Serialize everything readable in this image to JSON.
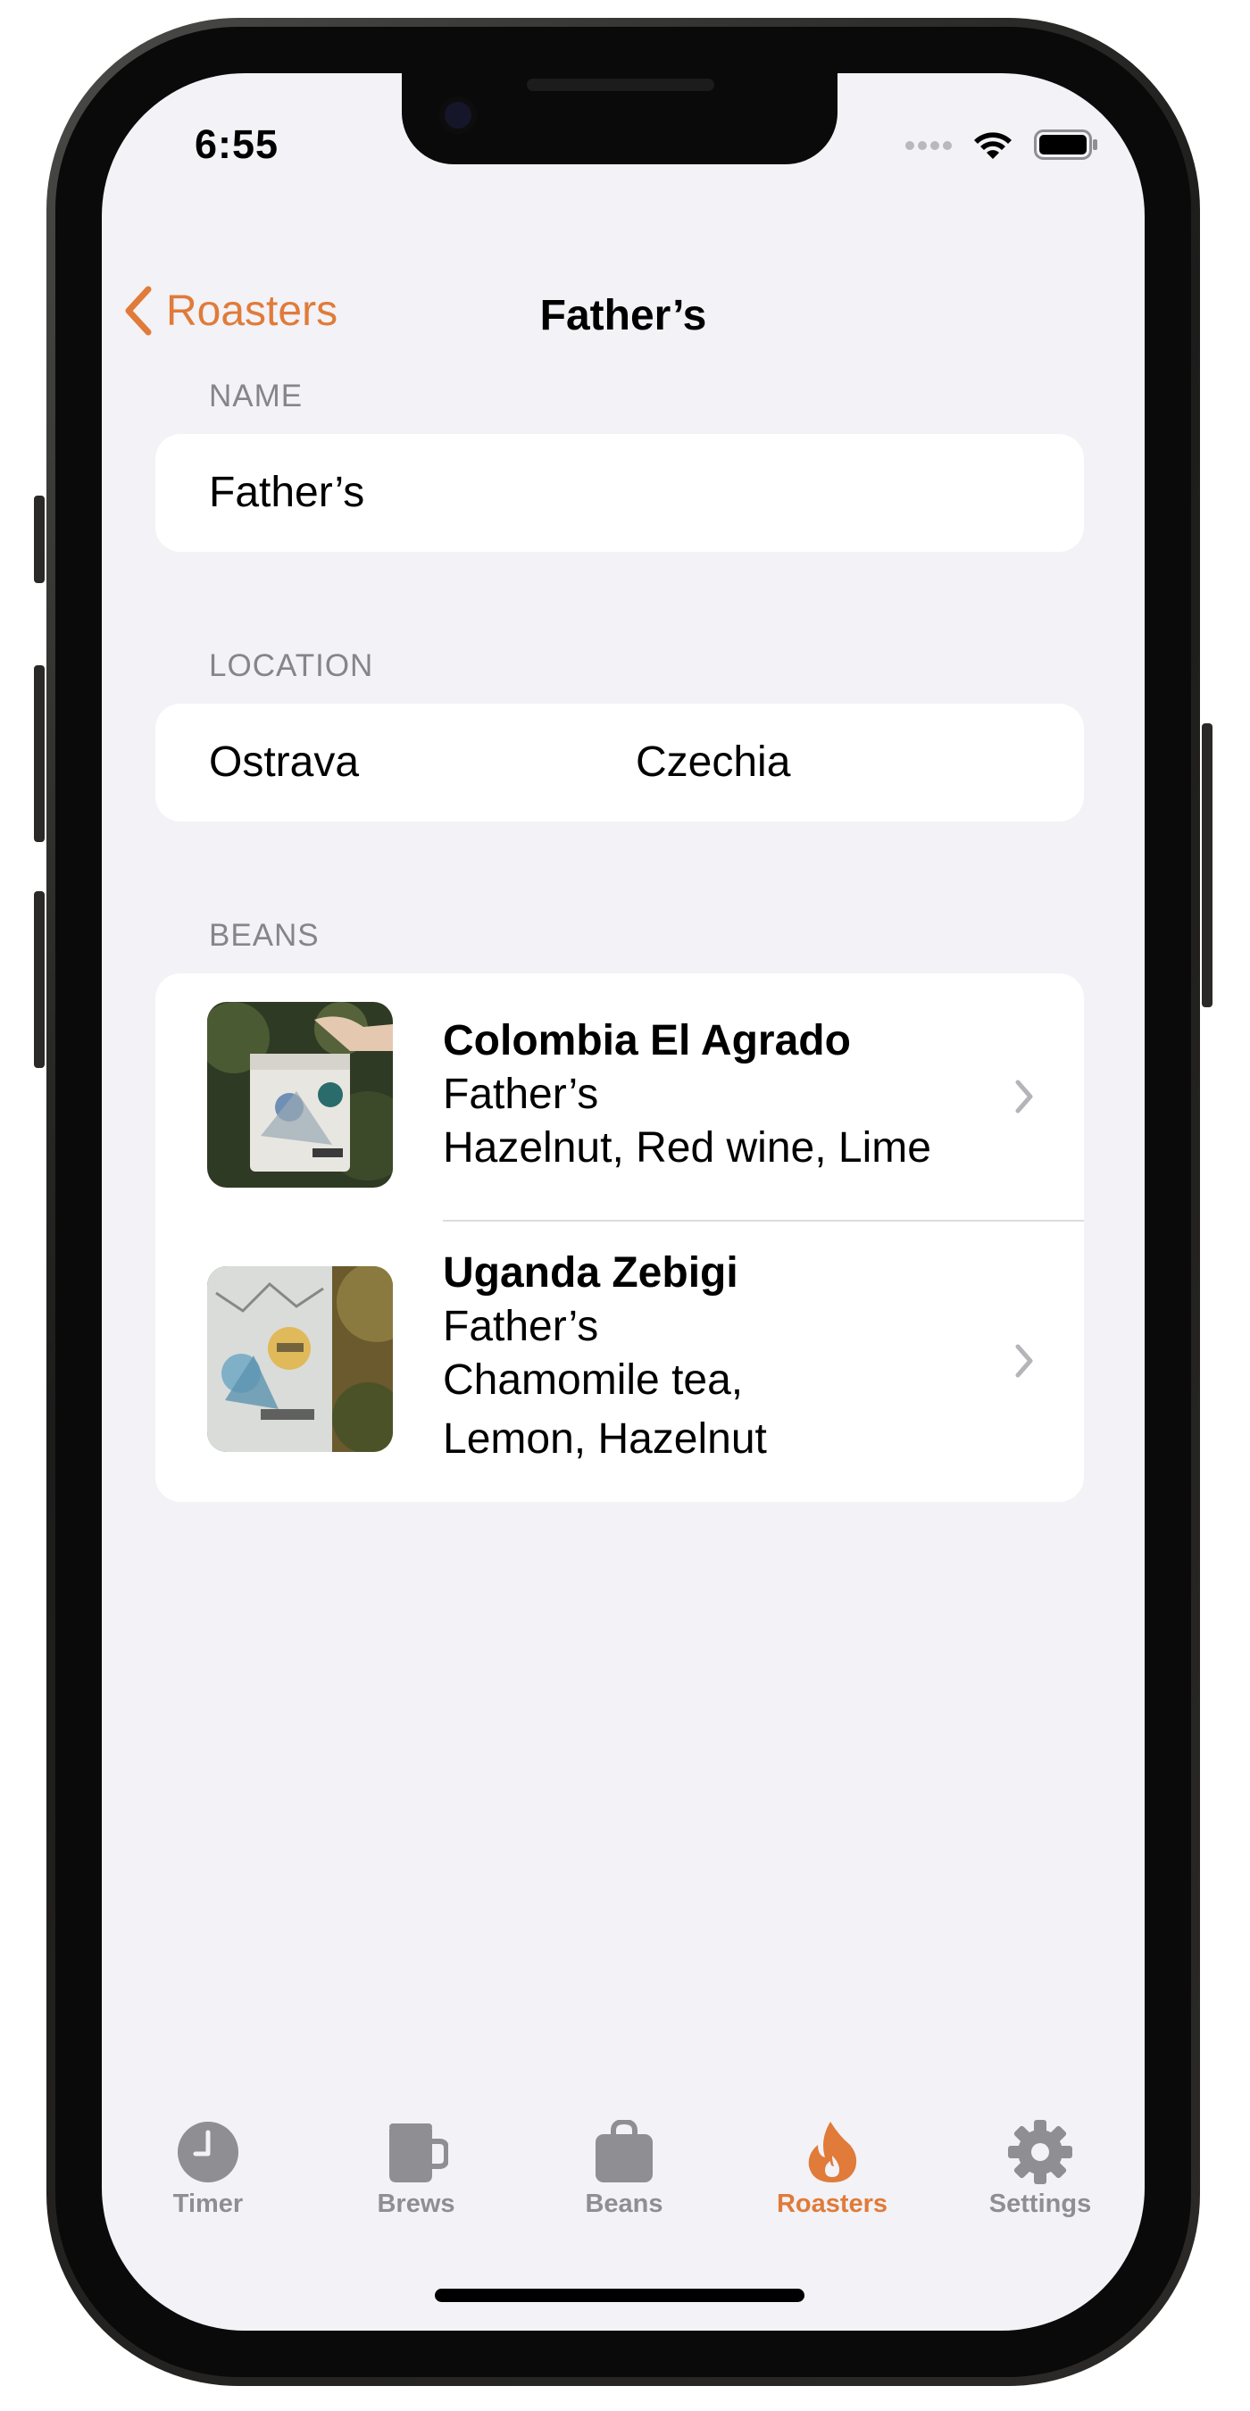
{
  "status_bar": {
    "time": "6:55"
  },
  "nav": {
    "back_label": "Roasters",
    "title": "Father’s"
  },
  "sections": {
    "name_label": "NAME",
    "location_label": "LOCATION",
    "beans_label": "BEANS"
  },
  "roaster": {
    "name": "Father’s",
    "city": "Ostrava",
    "country": "Czechia"
  },
  "beans": [
    {
      "name": "Colombia El Agrado",
      "roaster": "Father’s",
      "notes_line1": "Hazelnut, Red wine, Lime",
      "notes_line2": ""
    },
    {
      "name": "Uganda Zebigi",
      "roaster": "Father’s",
      "notes_line1": "Chamomile tea,",
      "notes_line2": "Lemon, Hazelnut"
    }
  ],
  "tabs": [
    {
      "label": "Timer",
      "icon": "clock-icon",
      "active": false
    },
    {
      "label": "Brews",
      "icon": "mug-icon",
      "active": false
    },
    {
      "label": "Beans",
      "icon": "bag-icon",
      "active": false
    },
    {
      "label": "Roasters",
      "icon": "flame-icon",
      "active": true
    },
    {
      "label": "Settings",
      "icon": "gear-icon",
      "active": false
    }
  ],
  "colors": {
    "accent": "#e07b39",
    "background": "#f2f2f7",
    "card": "#ffffff",
    "secondary_text": "#85858a",
    "inactive_tab": "#8e8e93"
  }
}
